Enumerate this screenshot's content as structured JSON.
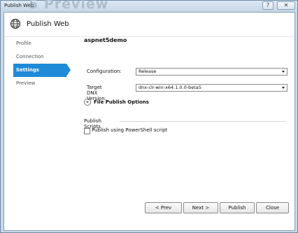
{
  "window": {
    "title": "Publish Web",
    "ghost_text": "5 Preview",
    "help_label": "?",
    "close_label": "✕"
  },
  "header": {
    "title": "Publish Web",
    "icon": "globe-icon"
  },
  "nav": {
    "items": [
      {
        "label": "Profile"
      },
      {
        "label": "Connection"
      },
      {
        "label": "Settings"
      },
      {
        "label": "Preview"
      }
    ]
  },
  "settings": {
    "project_name": "aspnet5demo",
    "configuration_label": "Configuration:",
    "configuration_value": "Release",
    "dnx_label": "Target DNX Version:",
    "dnx_value": "dnx-clr-win-x64.1.0.0-beta5",
    "file_publish_options": "File Publish Options",
    "publish_scripts_title": "Publish Scripts",
    "powershell_label": "Publish using PowerShell script"
  },
  "footer": {
    "prev": "< Prev",
    "next": "Next >",
    "publish": "Publish",
    "close": "Close"
  },
  "colors": {
    "accent": "#1f8ad8",
    "window_frame": "#c8d8e8"
  }
}
